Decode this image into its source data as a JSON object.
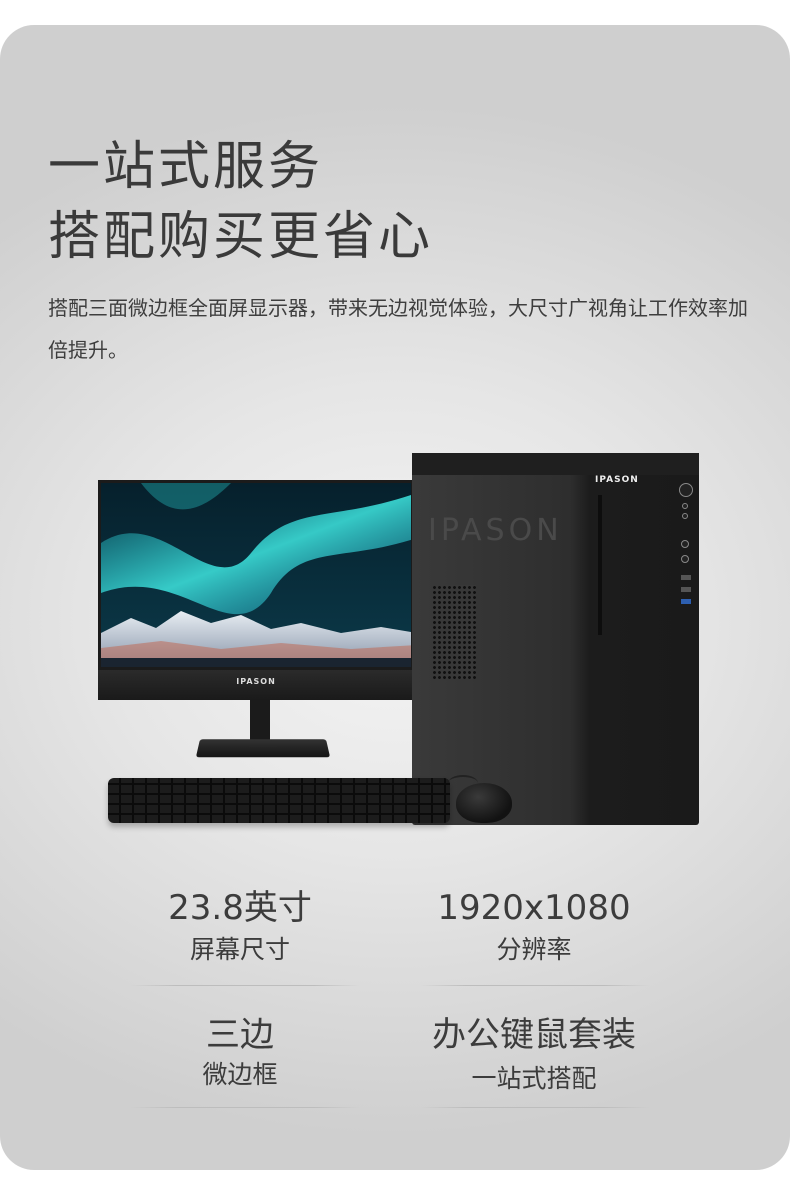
{
  "headline": {
    "line1": "一站式服务",
    "line2": "搭配购买更省心"
  },
  "description": "搭配三面微边框全面屏显示器，带来无边视觉体验，大尺寸广视角让工作效率加倍提升。",
  "product": {
    "monitor_brand": "IPASON",
    "tower_brand": "IPASON",
    "tower_emboss": "IPASON"
  },
  "specs": [
    {
      "value": "23.8英寸",
      "label": "屏幕尺寸"
    },
    {
      "value": "1920x1080",
      "label": "分辨率"
    },
    {
      "value": "三边",
      "label": "微边框"
    },
    {
      "value": "办公键鼠套装",
      "label": "一站式搭配"
    }
  ],
  "colors": {
    "background": "#dcdcdc",
    "text": "#3a3a3a",
    "aurora": "#2fd1d6"
  }
}
